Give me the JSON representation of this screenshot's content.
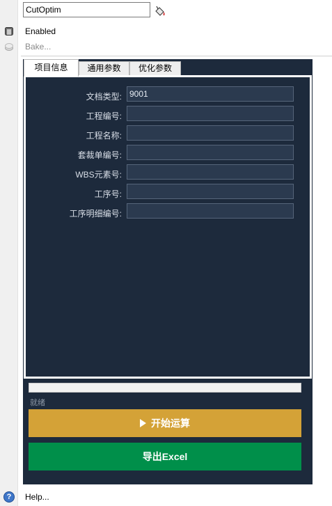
{
  "component": {
    "name_value": "CutOptim",
    "enabled_label": "Enabled",
    "bake_label": "Bake...",
    "help_label": "Help..."
  },
  "tabs": [
    {
      "label": "项目信息",
      "active": true
    },
    {
      "label": "通用参数",
      "active": false
    },
    {
      "label": "优化参数",
      "active": false
    }
  ],
  "fields": [
    {
      "label": "文档类型:",
      "value": "9001"
    },
    {
      "label": "工程编号:",
      "value": ""
    },
    {
      "label": "工程名称:",
      "value": ""
    },
    {
      "label": "套裁单编号:",
      "value": ""
    },
    {
      "label": "WBS元素号:",
      "value": ""
    },
    {
      "label": "工序号:",
      "value": ""
    },
    {
      "label": "工序明细编号:",
      "value": ""
    }
  ],
  "progress": {
    "value": 0
  },
  "status_text": "就绪",
  "actions": {
    "run_label": "开始运算",
    "export_label": "导出Excel"
  },
  "colors": {
    "panel_bg": "#1d2a3c",
    "input_bg": "#2b3a4f",
    "run_button": "#d4a237",
    "export_button": "#008f4a"
  },
  "icons": {
    "bucket": "paint-bucket-icon",
    "enabled": "enabled-icon",
    "bake": "bake-icon",
    "help": "help-icon",
    "play": "play-icon"
  }
}
